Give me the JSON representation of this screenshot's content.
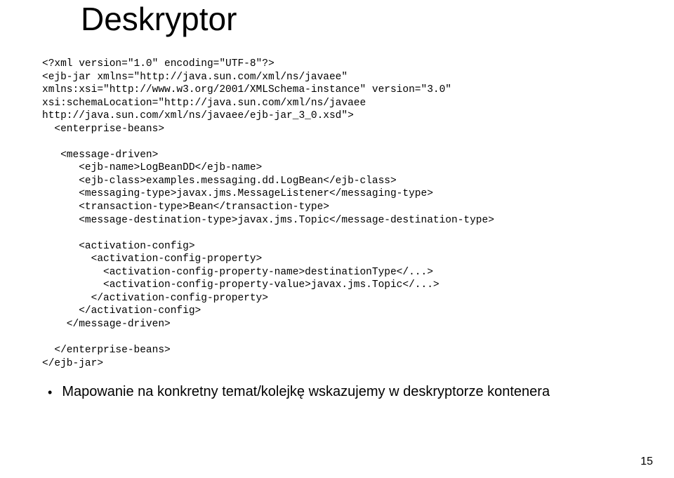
{
  "title": "Deskryptor",
  "code_lines": [
    "<?xml version=\"1.0\" encoding=\"UTF-8\"?>",
    "<ejb-jar xmlns=\"http://java.sun.com/xml/ns/javaee\"",
    "xmlns:xsi=\"http://www.w3.org/2001/XMLSchema-instance\" version=\"3.0\"",
    "xsi:schemaLocation=\"http://java.sun.com/xml/ns/javaee",
    "http://java.sun.com/xml/ns/javaee/ejb-jar_3_0.xsd\">",
    "  <enterprise-beans>",
    "",
    "   <message-driven>",
    "      <ejb-name>LogBeanDD</ejb-name>",
    "      <ejb-class>examples.messaging.dd.LogBean</ejb-class>",
    "      <messaging-type>javax.jms.MessageListener</messaging-type>",
    "      <transaction-type>Bean</transaction-type>",
    "      <message-destination-type>javax.jms.Topic</message-destination-type>",
    "",
    "      <activation-config>",
    "        <activation-config-property>",
    "          <activation-config-property-name>destinationType</...>",
    "          <activation-config-property-value>javax.jms.Topic</...>",
    "        </activation-config-property>",
    "      </activation-config>",
    "    </message-driven>",
    "",
    "  </enterprise-beans>",
    "</ejb-jar>"
  ],
  "bullet": "Mapowanie na konkretny temat/kolejkę wskazujemy w deskryptorze kontenera",
  "page_number": "15"
}
